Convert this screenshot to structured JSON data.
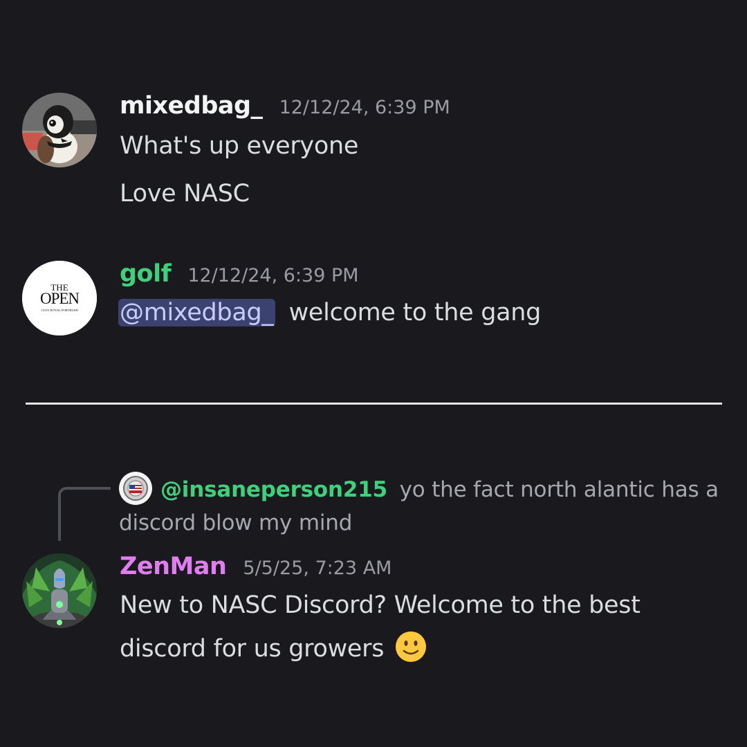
{
  "messages": [
    {
      "username": "mixedbag_",
      "username_color": "#f2f3f5",
      "timestamp": "12/12/24, 6:39 PM",
      "lines": [
        "What's up everyone",
        "Love NASC"
      ]
    },
    {
      "username": "golf",
      "username_color": "#3fd07c",
      "timestamp": "12/12/24, 6:39 PM",
      "mention": "@mixedbag_",
      "text": "welcome to the gang",
      "avatar_text": {
        "line1": "THE",
        "line2": "OPEN",
        "line3": "151ST ROYAL PORTRUSH"
      }
    },
    {
      "reply": {
        "username": "@insaneperson215",
        "text": "yo the fact north alantic has a discord blow my mind"
      },
      "username": "ZenMan",
      "username_color": "#e07ef0",
      "timestamp": "5/5/25, 7:23 AM",
      "lines": [
        "New to NASC Discord? Welcome to the best",
        "discord for us growers"
      ],
      "emoji": "slightly-smiling-face"
    }
  ],
  "colors": {
    "background": "#1a1a1e",
    "mention_bg": "#3c4270",
    "mention_text": "#c9cdfb",
    "timestamp": "#9b9ca3",
    "divider": "#e6e6e6"
  }
}
